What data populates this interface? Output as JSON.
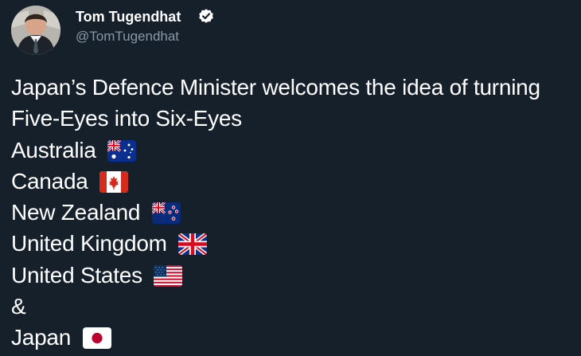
{
  "author": {
    "name": "Tom Tugendhat",
    "handle": "@TomTugendhat",
    "verified": true
  },
  "tweet": {
    "lines": [
      "Japan’s Defence Minister welcomes the idea of turning",
      "Five-Eyes into Six-Eyes",
      "Australia",
      "Canada",
      "New Zealand",
      "United Kingdom",
      "United States",
      "&",
      "Japan"
    ],
    "flags": {
      "australia": "australia-flag-icon",
      "canada": "canada-flag-icon",
      "new_zealand": "new-zealand-flag-icon",
      "united_kingdom": "united-kingdom-flag-icon",
      "united_states": "united-states-flag-icon",
      "japan": "japan-flag-icon"
    }
  },
  "colors": {
    "background": "#15202b",
    "text": "#ffffff",
    "secondary_text": "#8899a6"
  }
}
